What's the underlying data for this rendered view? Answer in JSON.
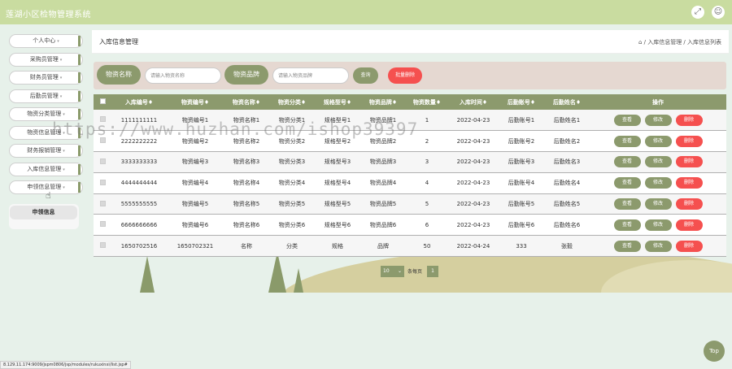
{
  "header": {
    "app_title": "莲湖小区检物管理系统",
    "fullscreen_icon": "expand-icon",
    "user_icon": "user-icon"
  },
  "sidebar": {
    "items": [
      {
        "label": "个人中心"
      },
      {
        "label": "采购员管理"
      },
      {
        "label": "财务员管理"
      },
      {
        "label": "后勤员管理"
      },
      {
        "label": "物资分类管理"
      },
      {
        "label": "物资信息管理"
      },
      {
        "label": "财务报销管理"
      },
      {
        "label": "入库信息管理"
      },
      {
        "label": "申领信息管理"
      }
    ],
    "submenu_label": "申领信息",
    "caret": "▾"
  },
  "breadcrumb": {
    "page_title": "入库信息管理",
    "path": "⌂ / 入库信息管理 / 入库信息列表"
  },
  "search": {
    "name_label": "物资名称",
    "name_placeholder": "请输入物资名称",
    "brand_label": "物资品牌",
    "brand_placeholder": "请输入物资品牌",
    "search_button": "查询",
    "batch_delete_button": "批量删除"
  },
  "table": {
    "headers": [
      "入库编号",
      "物资编号",
      "物资名称",
      "物资分类",
      "规格型号",
      "物资品牌",
      "物资数量",
      "入库时间",
      "后勤账号",
      "后勤姓名",
      "操作"
    ],
    "sort_mark": "♦",
    "rows": [
      [
        "1111111111",
        "物资编号1",
        "物资名称1",
        "物资分类1",
        "规格型号1",
        "物资品牌1",
        "1",
        "2022-04-23",
        "后勤账号1",
        "后勤姓名1"
      ],
      [
        "2222222222",
        "物资编号2",
        "物资名称2",
        "物资分类2",
        "规格型号2",
        "物资品牌2",
        "2",
        "2022-04-23",
        "后勤账号2",
        "后勤姓名2"
      ],
      [
        "3333333333",
        "物资编号3",
        "物资名称3",
        "物资分类3",
        "规格型号3",
        "物资品牌3",
        "3",
        "2022-04-23",
        "后勤账号3",
        "后勤姓名3"
      ],
      [
        "4444444444",
        "物资编号4",
        "物资名称4",
        "物资分类4",
        "规格型号4",
        "物资品牌4",
        "4",
        "2022-04-23",
        "后勤账号4",
        "后勤姓名4"
      ],
      [
        "5555555555",
        "物资编号5",
        "物资名称5",
        "物资分类5",
        "规格型号5",
        "物资品牌5",
        "5",
        "2022-04-23",
        "后勤账号5",
        "后勤姓名5"
      ],
      [
        "6666666666",
        "物资编号6",
        "物资名称6",
        "物资分类6",
        "规格型号6",
        "物资品牌6",
        "6",
        "2022-04-23",
        "后勤账号6",
        "后勤姓名6"
      ],
      [
        "1650702516",
        "1650702321",
        "名称",
        "分类",
        "规格",
        "品牌",
        "50",
        "2022-04-24",
        "333",
        "张毅"
      ]
    ],
    "actions": {
      "view": "查看",
      "edit": "修改",
      "delete": "删除"
    }
  },
  "pagination": {
    "page_size": "10",
    "per_page_label": "条每页",
    "current_page": "1"
  },
  "watermark": "https://www.huzhan.com/ishop39397",
  "back_to_top": "Top",
  "status_url": "8.129.11.174:9009/jspm0806/jsp/modules/rukuxinxi/list.jsp#",
  "colors": {
    "accent": "#8c9a6d",
    "danger": "#f5504f",
    "topbar": "#c9dca0",
    "background": "#e7f1ea"
  }
}
